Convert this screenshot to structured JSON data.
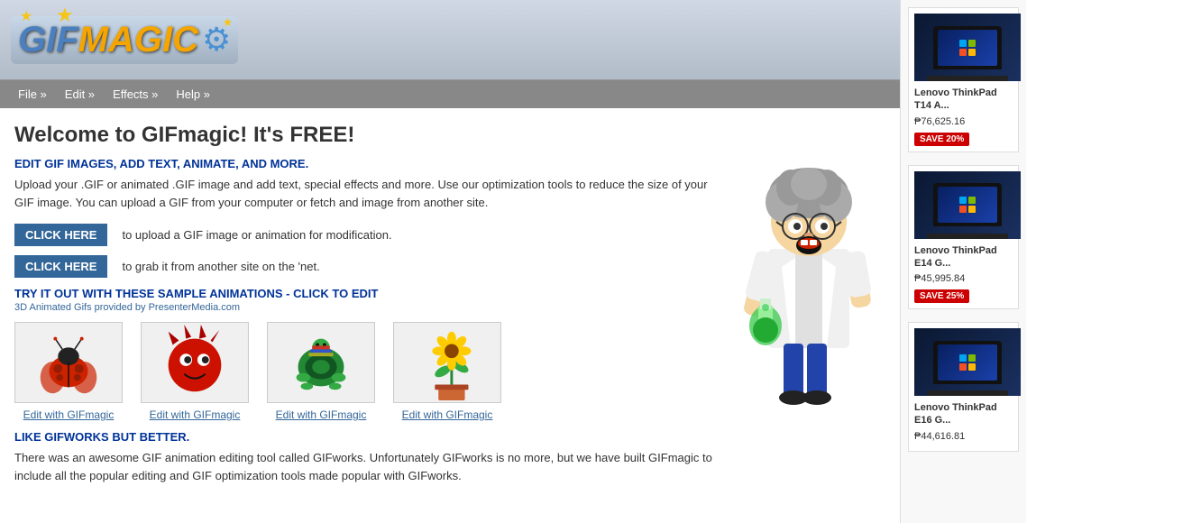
{
  "logo": {
    "gif_text": "GIF",
    "magic_text": "MAGIC",
    "star_symbol": "★"
  },
  "navbar": {
    "items": [
      {
        "label": "File »",
        "id": "file"
      },
      {
        "label": "Edit »",
        "id": "edit"
      },
      {
        "label": "Effects »",
        "id": "effects"
      },
      {
        "label": "Help »",
        "id": "help"
      }
    ]
  },
  "main": {
    "welcome_title": "Welcome to GIFmagic! It's FREE!",
    "subtitle": "EDIT GIF IMAGES, ADD TEXT, ANIMATE, AND MORE.",
    "description": "Upload your .GIF or animated .GIF image and add text, special effects and more. Use our optimization tools to reduce the size of your GIF image. You can upload a GIF from your computer or fetch and image from another site.",
    "click_here_label_1": "CLICK HERE",
    "click_here_desc_1": "to upload a GIF image or animation for modification.",
    "click_here_label_2": "CLICK HERE",
    "click_here_desc_2": "to grab it from another site on the 'net.",
    "samples_title": "TRY IT OUT WITH THESE SAMPLE ANIMATIONS - CLICK TO EDIT",
    "samples_credit": "3D Animated Gifs provided by PresenterMedia.com",
    "sample_link_label": "Edit with GIFmagic",
    "samples": [
      {
        "id": "ladybug",
        "label": "Edit with GIFmagic",
        "color1": "#cc2200",
        "color2": "#880000"
      },
      {
        "id": "red-monster",
        "label": "Edit with GIFmagic",
        "color1": "#cc2200",
        "color2": "#aa0000"
      },
      {
        "id": "turtle",
        "label": "Edit with GIFmagic",
        "color1": "#228833",
        "color2": "#115522"
      },
      {
        "id": "sunflower",
        "label": "Edit with GIFmagic",
        "color1": "#ddaa00",
        "color2": "#886600"
      }
    ],
    "like_title": "LIKE GIFWORKS BUT BETTER.",
    "like_desc": "There was an awesome GIF animation editing tool called GIFworks. Unfortunately GIFworks is no more, but we have built GIFmagic to include all the popular editing and GIF optimization tools made popular with GIFworks."
  },
  "sidebar": {
    "products": [
      {
        "name": "Lenovo ThinkPad T14 A...",
        "price": "₱76,625.16",
        "save": "SAVE 20%",
        "has_badge": true
      },
      {
        "name": "Lenovo ThinkPad E14 G...",
        "price": "₱45,995.84",
        "save": "SAVE 25%",
        "has_badge": true
      },
      {
        "name": "Lenovo ThinkPad E16 G...",
        "price": "₱44,616.81",
        "save": "",
        "has_badge": false
      }
    ]
  }
}
